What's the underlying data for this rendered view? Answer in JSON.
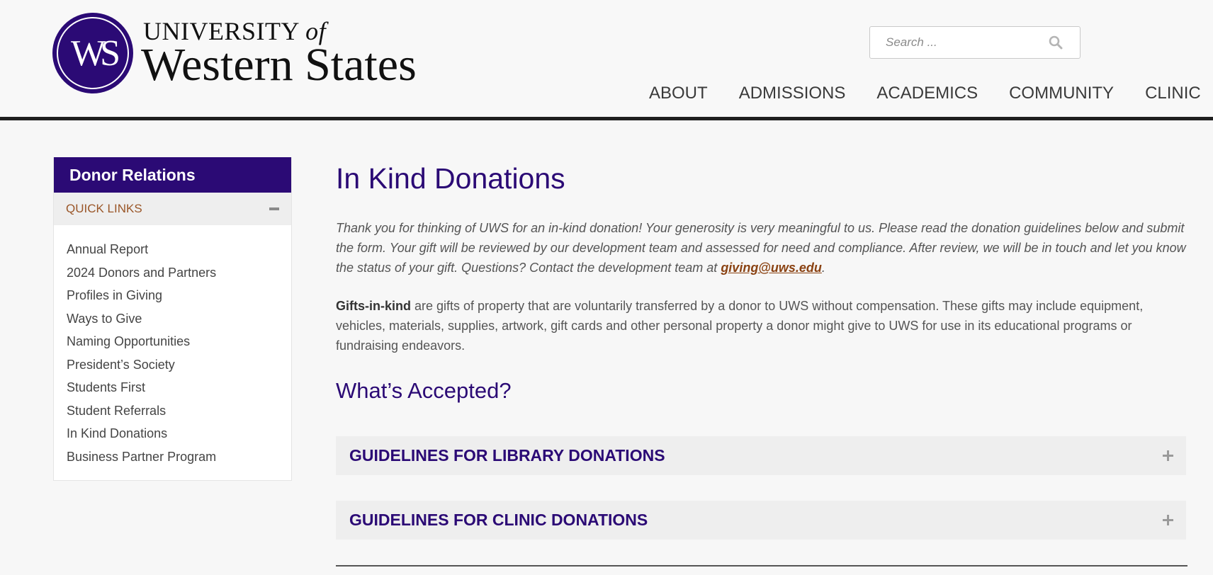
{
  "brand": {
    "monogram": "WS",
    "line1": "UNIVERSITY",
    "line1_of": "of",
    "line2": "Western States",
    "color": "#2b0a75"
  },
  "search": {
    "placeholder": "Search ...",
    "icon": "search-icon"
  },
  "nav": {
    "items": [
      "ABOUT",
      "ADMISSIONS",
      "ACADEMICS",
      "COMMUNITY",
      "CLINIC"
    ]
  },
  "sidebar": {
    "title": "Donor Relations",
    "quick_links_label": "QUICK LINKS",
    "toggle_icon": "minus-icon",
    "items": [
      "Annual Report",
      "2024 Donors and Partners",
      "Profiles in Giving",
      "Ways to Give",
      "Naming Opportunities",
      "President’s Society",
      "Students First",
      "Student Referrals",
      "In Kind Donations",
      "Business Partner Program"
    ]
  },
  "main": {
    "title": "In Kind Donations",
    "intro_before": "Thank you for thinking of UWS for an in-kind donation! Your generosity is very meaningful to us. Please read the donation guidelines below and submit the form. Your gift will be reviewed by our development team and assessed for need and compliance. After review, we will be in touch and let you know the status of your gift. Questions? Contact the development team at ",
    "intro_email": "giving@uws.edu",
    "intro_after": ".",
    "gifts_bold": "Gifts-in-kind",
    "gifts_text": " are gifts of property that are voluntarily transferred by a donor to UWS without compensation. These gifts may include equipment, vehicles, materials, supplies, artwork, gift cards and other personal property a donor might give to UWS for use in its educational programs or fundraising endeavors.",
    "section_heading": "What’s Accepted?",
    "accordions": [
      "GUIDELINES FOR LIBRARY DONATIONS",
      "GUIDELINES FOR CLINIC DONATIONS"
    ]
  },
  "colors": {
    "purple": "#2b0a75",
    "link_brown": "#8a4212",
    "quick_links_brown": "#9a5628"
  }
}
